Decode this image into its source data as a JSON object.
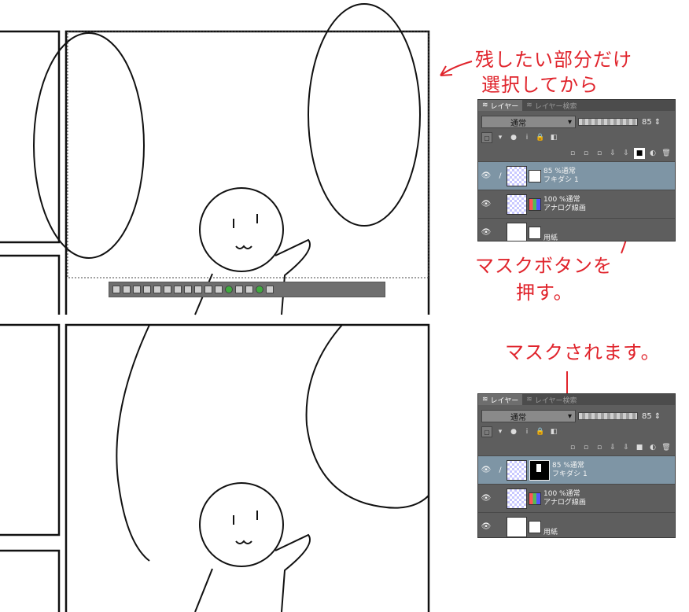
{
  "annotations": {
    "top_right_line1": "残したい部分だけ",
    "top_right_line2": "選択してから",
    "middle": "マスクボタンを",
    "middle2": "押す。",
    "bottom": "マスクされます。"
  },
  "layer_panel": {
    "tab_layer": "レイヤー",
    "tab_search": "レイヤー検索",
    "blend_mode": "通常",
    "opacity": "85",
    "layers": [
      {
        "line1": "85 %通常",
        "line2": "フキダシ 1"
      },
      {
        "line1": "100 %通常",
        "line2": "アナログ線画"
      },
      {
        "line1": "用紙",
        "line2": ""
      }
    ]
  },
  "icons": [
    "eye-icon",
    "pen-icon",
    "mask-icon",
    "trash-icon",
    "new-layer-icon",
    "lock-icon"
  ],
  "colors": {
    "annotation_red": "#e0242c",
    "panel_bg": "#5e5e5e",
    "selected_layer": "#7e95a5"
  }
}
